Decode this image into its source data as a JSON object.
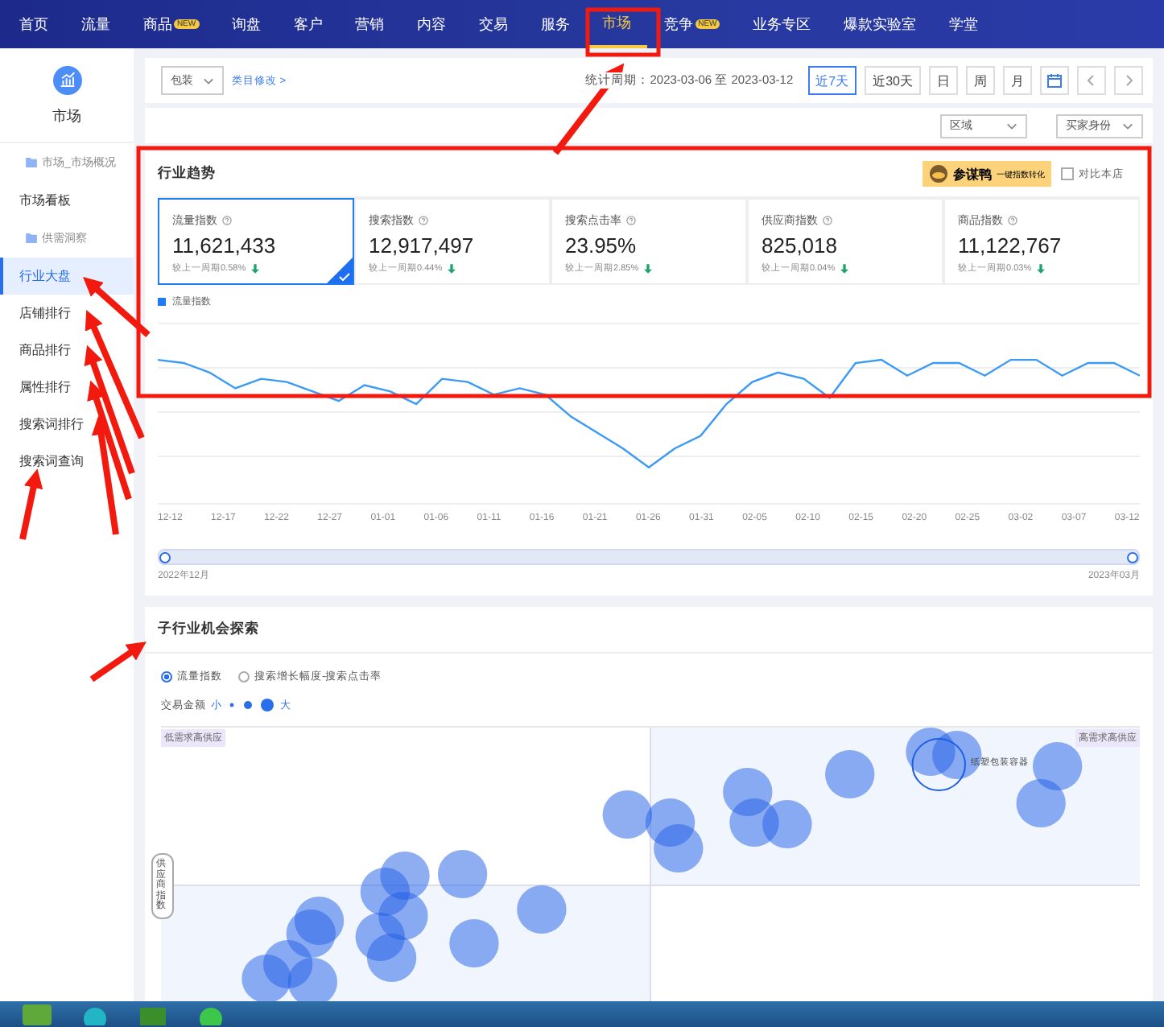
{
  "nav": [
    {
      "label": "首页",
      "selected": false
    },
    {
      "label": "流量",
      "selected": false
    },
    {
      "label": "商品",
      "badge": "NEW",
      "selected": false
    },
    {
      "label": "询盘",
      "selected": false
    },
    {
      "label": "客户",
      "selected": false
    },
    {
      "label": "营销",
      "selected": false
    },
    {
      "label": "内容",
      "selected": false
    },
    {
      "label": "交易",
      "selected": false
    },
    {
      "label": "服务",
      "selected": false
    },
    {
      "label": "市场",
      "selected": true
    },
    {
      "label": "竞争",
      "badge": "NEW",
      "selected": false
    },
    {
      "label": "业务专区",
      "selected": false
    },
    {
      "label": "爆款实验室",
      "selected": false
    },
    {
      "label": "学堂",
      "selected": false
    }
  ],
  "sidebar": {
    "title": "市场",
    "items": [
      {
        "kind": "group",
        "label": "市场_市场概况",
        "selected": false
      },
      {
        "kind": "link",
        "label": "市场看板",
        "selected": false
      },
      {
        "kind": "group",
        "label": "供需洞察",
        "selected": false
      },
      {
        "kind": "link",
        "label": "行业大盘",
        "selected": true
      },
      {
        "kind": "link",
        "label": "店铺排行",
        "selected": false
      },
      {
        "kind": "link",
        "label": "商品排行",
        "selected": false
      },
      {
        "kind": "link",
        "label": "属性排行",
        "selected": false
      },
      {
        "kind": "link",
        "label": "搜索词排行",
        "selected": false
      },
      {
        "kind": "link",
        "label": "搜索词查询",
        "selected": false
      }
    ]
  },
  "filters": {
    "category": "包装",
    "category_link": "类目修改 >",
    "period": "统计周期：2023-03-06 至 2023-03-12",
    "ranges": [
      {
        "label": "近7天",
        "selected": true
      },
      {
        "label": "近30天",
        "selected": false
      },
      {
        "label": "日",
        "selected": false
      },
      {
        "label": "周",
        "selected": false
      },
      {
        "label": "月",
        "selected": false
      }
    ],
    "dropdowns": [
      "区域",
      "买家身份"
    ]
  },
  "trend": {
    "title": "行业趋势",
    "plugin": "参谋鸭",
    "plugin_hint": "一键指数转化",
    "compare": {
      "label": "对比本店",
      "checked": false
    },
    "cards": [
      {
        "title": "流量指数",
        "value": "11,621,433",
        "change": "较上一周期0.58%",
        "declined": true,
        "selected": true
      },
      {
        "title": "搜索指数",
        "value": "12,917,497",
        "change": "较上一周期0.44%",
        "declined": true,
        "selected": false
      },
      {
        "title": "搜索点击率",
        "value": "23.95%",
        "change": "较上一周期2.85%",
        "declined": true,
        "selected": false
      },
      {
        "title": "供应商指数",
        "value": "825,018",
        "change": "较上一周期0.04%",
        "declined": true,
        "selected": false
      },
      {
        "title": "商品指数",
        "value": "11,122,767",
        "change": "较上一周期0.03%",
        "declined": true,
        "selected": false
      }
    ],
    "legend": "流量指数",
    "x_labels": [
      "12-12",
      "12-17",
      "12-22",
      "12-27",
      "01-01",
      "01-06",
      "01-11",
      "01-16",
      "01-21",
      "01-26",
      "01-31",
      "02-05",
      "02-10",
      "02-15",
      "02-20",
      "02-25",
      "03-02",
      "03-07",
      "03-12"
    ],
    "range": {
      "level": 1
    },
    "range_start": "2022年12月",
    "range_end": "2023年03月"
  },
  "explore": {
    "title": "子行业机会探索",
    "modes": [
      {
        "label": "流量指数",
        "selected": true
      },
      {
        "label": "搜索增长幅度-搜索点击率",
        "selected": false
      }
    ],
    "size_label": "交易金额",
    "size_small": "小",
    "size_large": "大",
    "quadrant_left": "低需求高供应",
    "quadrant_right": "高需求高供应",
    "highlight": "纸塑包装容器",
    "y_axis": "供应商指数"
  }
}
